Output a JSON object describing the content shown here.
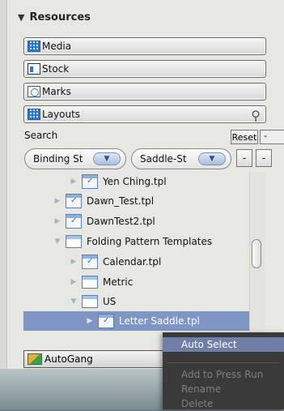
{
  "resources": {
    "title": "Resources",
    "panels": [
      {
        "label": "Media",
        "icon": "grid-icon"
      },
      {
        "label": "Stock",
        "icon": "stock-icon"
      },
      {
        "label": "Marks",
        "icon": "marks-icon"
      },
      {
        "label": "Layouts",
        "icon": "grid-icon"
      }
    ]
  },
  "search": {
    "label": "Search",
    "reset_label": "Reset",
    "edge_label": "-"
  },
  "filters": {
    "binding": "Binding St",
    "saddle": "Saddle-St",
    "minus1": "-",
    "minus2": "-"
  },
  "tree": [
    {
      "label": "Yen Ching.tpl",
      "type": "file",
      "depth": 2,
      "expanded": false
    },
    {
      "label": "Dawn_Test.tpl",
      "type": "file",
      "depth": 1,
      "expanded": false
    },
    {
      "label": "DawnTest2.tpl",
      "type": "file",
      "depth": 1,
      "expanded": false
    },
    {
      "label": "Folding Pattern Templates",
      "type": "folder",
      "depth": 1,
      "expanded": true
    },
    {
      "label": "Calendar.tpl",
      "type": "file",
      "depth": 2,
      "expanded": false
    },
    {
      "label": "Metric",
      "type": "folder",
      "depth": 2,
      "expanded": false
    },
    {
      "label": "US",
      "type": "folder",
      "depth": 2,
      "expanded": true
    },
    {
      "label": "Letter Saddle.tpl",
      "type": "file",
      "depth": 3,
      "selected": true
    }
  ],
  "autogang": {
    "label": "AutoGang"
  },
  "context_menu": {
    "items": [
      {
        "label": "Auto Select",
        "state": "active"
      },
      {
        "label": "Add to Press Run",
        "state": "disabled"
      },
      {
        "label": "Rename",
        "state": "disabled"
      },
      {
        "label": "Delete",
        "state": "disabled"
      }
    ]
  },
  "colors": {
    "selection": "#7f95c4",
    "menu_bg": "#3a3a3a",
    "menu_highlight": "#6f7fa8"
  }
}
